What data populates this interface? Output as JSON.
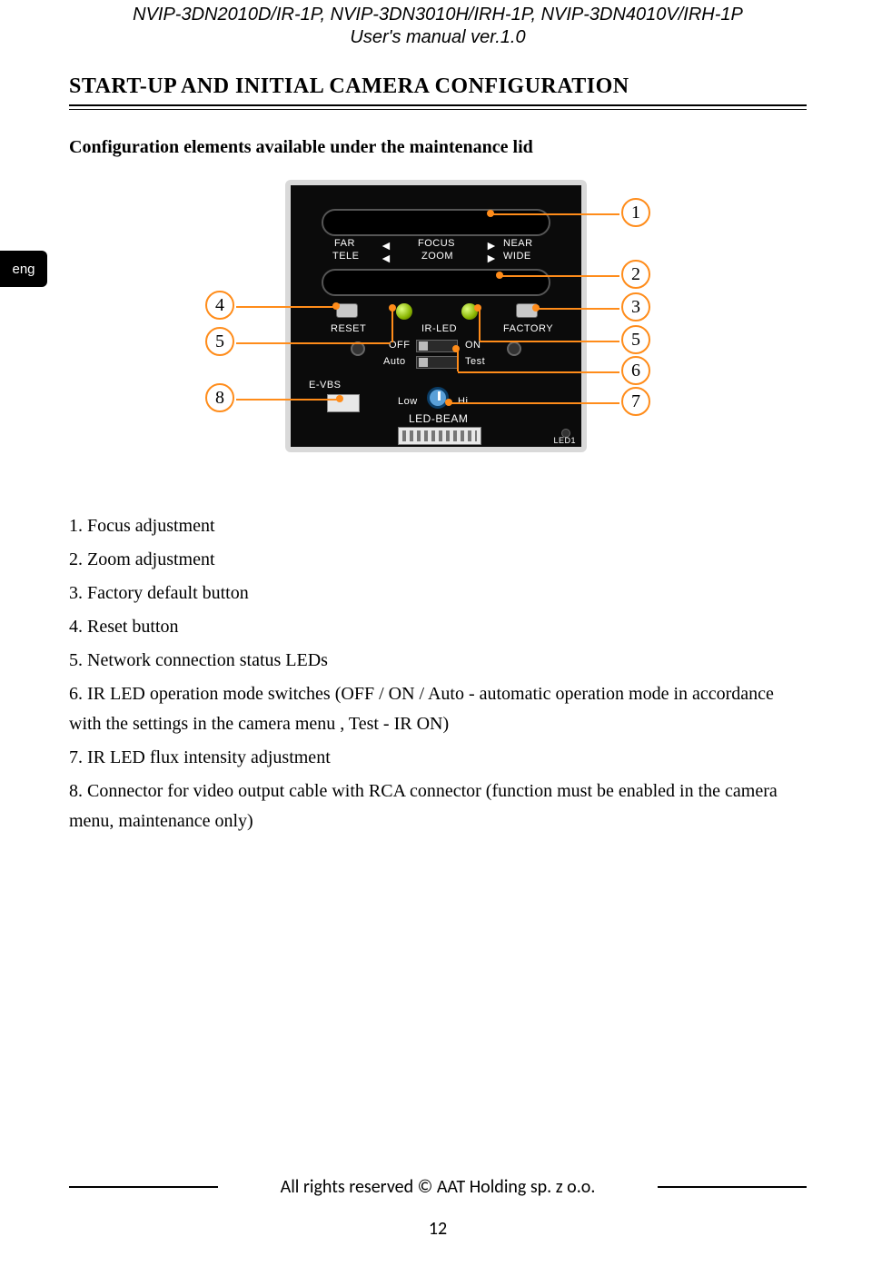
{
  "header": {
    "models": "NVIP-3DN2010D/IR-1P, NVIP-3DN3010H/IRH-1P, NVIP-3DN4010V/IRH-1P",
    "doc_title": "User's manual ver.1.0"
  },
  "section_title": "START-UP AND INITIAL CAMERA CONFIGURATION",
  "subheading": "Configuration elements available under the maintenance lid",
  "lang_tab": "eng",
  "board_labels": {
    "far": "FAR",
    "tele": "TELE",
    "focus": "FOCUS",
    "zoom": "ZOOM",
    "near": "NEAR",
    "wide": "WIDE",
    "reset": "RESET",
    "ir_led": "IR-LED",
    "factory": "FACTORY",
    "off": "OFF",
    "on": "ON",
    "auto": "Auto",
    "test": "Test",
    "e_vbs": "E-VBS",
    "low": "Low",
    "hi": "Hi",
    "led_beam": "LED-BEAM",
    "led1": "LED1"
  },
  "callouts": {
    "c1": "1",
    "c2": "2",
    "c3": "3",
    "c4": "4",
    "c5": "5",
    "c6": "6",
    "c7": "7",
    "c8": "8"
  },
  "items": [
    {
      "n": "1.",
      "text": "Focus adjustment"
    },
    {
      "n": "2.",
      "text": "Zoom adjustment"
    },
    {
      "n": "3.",
      "text": "Factory default button"
    },
    {
      "n": "4.",
      "text": "Reset button"
    },
    {
      "n": "5.",
      "text": "Network connection status LEDs"
    },
    {
      "n": "6.",
      "text": "IR LED operation mode switches (OFF / ON / Auto - automatic operation mode in accordance with the settings in the camera menu , Test - IR ON)"
    },
    {
      "n": "7.",
      "text": "IR LED flux intensity adjustment"
    },
    {
      "n": "8.",
      "text": "Connector for video output cable with RCA connector (function must be enabled in the camera menu, maintenance only)"
    }
  ],
  "footer": {
    "copyright": "All rights reserved © AAT Holding sp. z o.o.",
    "page_number": "12"
  }
}
